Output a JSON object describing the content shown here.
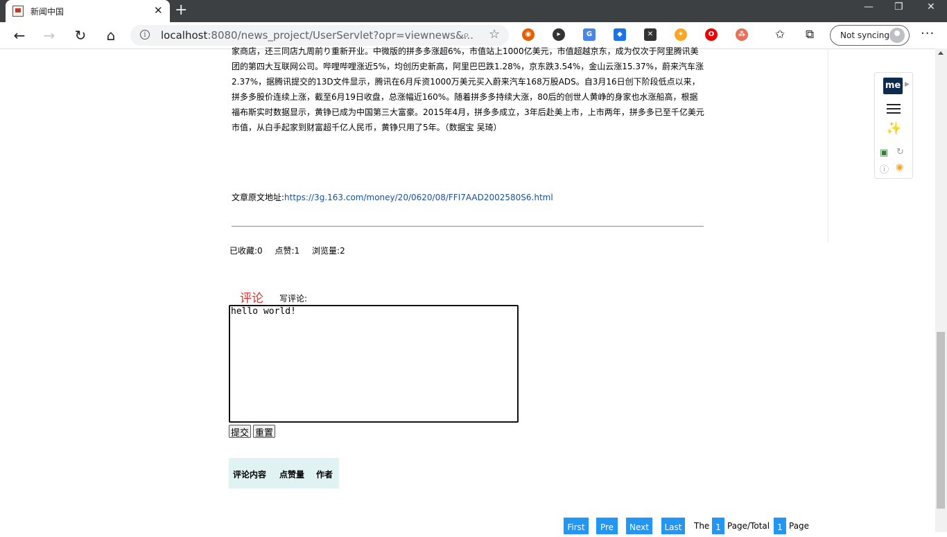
{
  "browser": {
    "tab_title": "新闻中国",
    "tab_close": "✕",
    "new_tab": "+",
    "window_controls": [
      "—",
      "❐",
      "✕"
    ],
    "url_host": "localhost",
    "url_rest": ":8080/news_project/UserServlet?opr=viewnews&...",
    "sync_label": "Not syncing",
    "more": "···",
    "info_glyph": "i"
  },
  "article": {
    "body": "家商店，还三同店九周前り重新开业。中微版的拼多多涨超6%，市值站上1000亿美元，市值超越京东，成为仅次于阿里腾讯美团的第四大互联网公司。哔哩哔哩涨近5%，均创历史新高，阿里巴巴跌1.28%，京东跌3.54%，金山云涨15.37%，蔚来汽车涨2.37%，据腾讯提交的13D文件显示，腾讯在6月斥资1000万美元买入蔚来汽车168万股ADS。自3月16日创下阶段低点以来，拼多多股价连续上涨，截至6月19日收盘，总涨幅近160%。随着拼多多持续大涨，80后的创世人黄峥的身家也水涨船高，根据福布斯实时数据显示，黄铮已成为中国第三大富豪。2015年4月，拼多多成立，3年后赴美上市，上市两年，拼多多已至千亿美元市值，从白手起家到财富超千亿人民币，黄铮只用了5年。（数据宝 吴琦）",
    "source_label": "文章原文地址:",
    "source_url": "https://3g.163.com/money/20/0620/08/FFI7AAD2002580S6.html"
  },
  "stats": {
    "collected": "已收藏:0",
    "likes": "点赞:1",
    "views": "浏览量:2"
  },
  "comment": {
    "title": "评论",
    "write_label": "写评论:",
    "value": "hello world!",
    "submit_label": "提交",
    "reset_label": "重置",
    "table_headers": [
      "评论内容",
      "点赞量",
      "作者"
    ]
  },
  "pager": {
    "first": "First",
    "prev": "Pre",
    "next": "Next",
    "last": "Last",
    "the": "The",
    "current_page": "1",
    "page_total": "Page/Total",
    "total_pages": "1",
    "page": "Page"
  },
  "extensions": {
    "me_logo": "me",
    "icon_names": [
      "firefox-icon",
      "circle-play-icon",
      "translate-icon",
      "graduation-cap-icon",
      "x-square-icon",
      "compass-icon",
      "opera-icon",
      "network-icon"
    ]
  },
  "colors": {
    "comment_title": "#e03030",
    "pager_button": "#2196f3",
    "table_header_bg": "#e0f2f1",
    "link": "#1a4f9e"
  }
}
